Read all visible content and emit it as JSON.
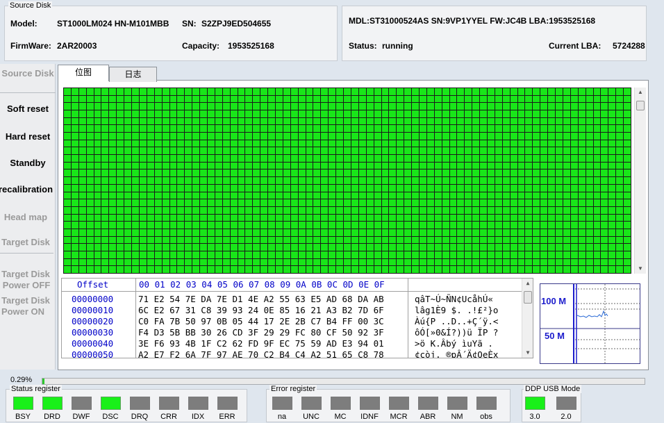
{
  "source_panel": {
    "title": "Source Disk",
    "model_label": "Model:",
    "model_value": "ST1000LM024 HN-M101MBB",
    "sn_label": "SN:",
    "sn_value": "S2ZPJ9ED504655",
    "firmware_label": "FirmWare:",
    "firmware_value": "2AR20003",
    "capacity_label": "Capacity:",
    "capacity_value": "1953525168"
  },
  "target_panel": {
    "info": "MDL:ST31000524AS  SN:9VP1YYEL  FW:JC4B  LBA:1953525168",
    "status_label": "Status:",
    "status_value": "running",
    "current_lba_label": "Current LBA:",
    "current_lba_value": "5724288 ("
  },
  "sidebar": {
    "source_disk": "Source Disk",
    "soft_reset": "Soft reset",
    "hard_reset": "Hard reset",
    "standby": "Standby",
    "recalibration": "recalibration",
    "head_map": "Head map",
    "target_disk": "Target Disk",
    "target_power_off_1": "Target Disk",
    "target_power_off_2": "Power OFF",
    "target_power_on_1": "Target Disk",
    "target_power_on_2": "Power ON"
  },
  "tabs": [
    {
      "label": "位图",
      "active": true
    },
    {
      "label": "日志",
      "active": false
    }
  ],
  "hex": {
    "offset_header": "Offset",
    "byte_header": "00 01 02 03 04 05 06 07 08 09 0A 0B 0C 0D 0E 0F",
    "rows": [
      {
        "offset": "00000000",
        "bytes": "71 E2 54 7E DA 7E D1 4E A2 55 63 E5 AD 68 DA AB",
        "ascii": "qâT~Ú~ÑN¢Ucå­hÚ«"
      },
      {
        "offset": "00000010",
        "bytes": "6C E2 67 31 C8 39 93 24 0E 85 16 21 A3 B2 7D 6F",
        "ascii": "lâg1È9 $. .!£²}o"
      },
      {
        "offset": "00000020",
        "bytes": "C0 FA 7B 50 97 0B 05 44 17 2E 2B C7 B4 FF 00 3C",
        "ascii": "Àú{P ..D..+Ç´ÿ.<"
      },
      {
        "offset": "00000030",
        "bytes": "F4 D3 5B BB 30 26 CD 3F 29 29 FC 80 CF 50 92 3F",
        "ascii": "ôÓ[»0&Í?))ü ÏP ?"
      },
      {
        "offset": "00000040",
        "bytes": "3E F6 93 4B 1F C2 62 FD 9F EC 75 59 AD E3 94 01",
        "ascii": ">ö K.Âbý ìuY­ã ."
      },
      {
        "offset": "00000050",
        "bytes": "A2 E7 F2 6A 7F 97 AE 70 C2 B4 C4 A2 51 65 C8 78",
        "ascii": "¢çòj. ®pÂ´Ä¢QeÈx"
      }
    ]
  },
  "graph": {
    "label_high": "100 M",
    "label_low": "50 M"
  },
  "progress": {
    "label": "0.29%",
    "percent": 0.29
  },
  "status_register": {
    "title": "Status register",
    "bits": [
      {
        "label": "BSY",
        "on": true
      },
      {
        "label": "DRD",
        "on": true
      },
      {
        "label": "DWF",
        "on": false
      },
      {
        "label": "DSC",
        "on": true
      },
      {
        "label": "DRQ",
        "on": false
      },
      {
        "label": "CRR",
        "on": false
      },
      {
        "label": "IDX",
        "on": false
      },
      {
        "label": "ERR",
        "on": false
      }
    ]
  },
  "error_register": {
    "title": "Error register",
    "bits": [
      {
        "label": "na",
        "on": false
      },
      {
        "label": "UNC",
        "on": false
      },
      {
        "label": "MC",
        "on": false
      },
      {
        "label": "IDNF",
        "on": false
      },
      {
        "label": "MCR",
        "on": false
      },
      {
        "label": "ABR",
        "on": false
      },
      {
        "label": "NM",
        "on": false
      },
      {
        "label": "obs",
        "on": false
      }
    ]
  },
  "ddp_usb": {
    "title": "DDP USB Mode",
    "bits": [
      {
        "label": "3.0",
        "on": true
      },
      {
        "label": "2.0",
        "on": false
      }
    ]
  },
  "colors": {
    "block_ok": "#19e619",
    "led_on": "#19f019",
    "led_off": "#7d7d7d",
    "hex_blue": "#0000c8"
  }
}
